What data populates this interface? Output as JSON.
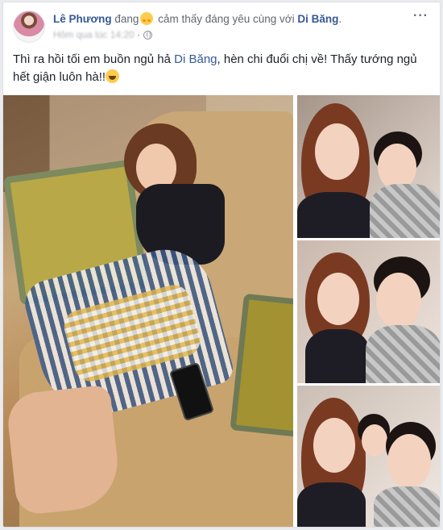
{
  "post": {
    "author": "Lê Phương",
    "action_prefix": "đang",
    "feeling": "cảm thấy đáng yêu cùng với",
    "tagged": "Di Băng",
    "tagged_suffix": ".",
    "timestamp": "Hôm qua lúc 14:20",
    "privacy_icon": "globe-icon",
    "more_icon": "ellipsis-icon",
    "more_label": "···",
    "text_before": "Thì ra hồi tối em buồn ngủ hả ",
    "text_mention": "Di Băng",
    "text_after": ", hèn chi đuổi chị về! Thấy tướng ngủ hết giận luôn hà!!"
  },
  "colors": {
    "link": "#365899",
    "text": "#1d2129",
    "muted": "#90949c",
    "card_bg": "#ffffff",
    "page_bg": "#e9ebee"
  },
  "photos": [
    {
      "name": "main-photo"
    },
    {
      "name": "photo-thumb-1"
    },
    {
      "name": "photo-thumb-2"
    },
    {
      "name": "photo-thumb-3"
    }
  ]
}
